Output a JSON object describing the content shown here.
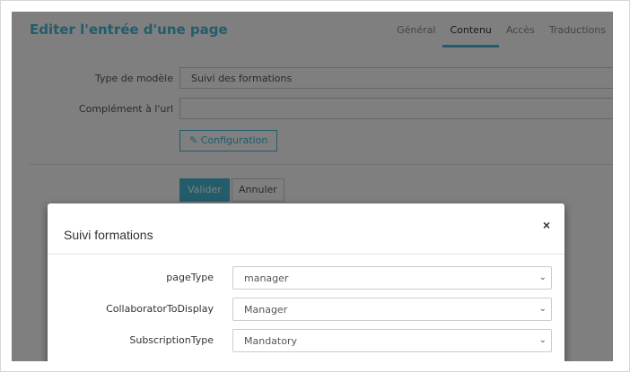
{
  "page": {
    "title": "Editer l'entrée d'une page",
    "tabs": [
      {
        "label": "Général",
        "active": false
      },
      {
        "label": "Contenu",
        "active": true
      },
      {
        "label": "Accès",
        "active": false
      },
      {
        "label": "Traductions",
        "active": false
      }
    ]
  },
  "form": {
    "template_type_label": "Type de modèle",
    "template_type_value": "Suivi des formations",
    "url_suffix_label": "Complément à l'url",
    "url_suffix_value": "",
    "config_button": "Configuration",
    "validate_button": "Valider",
    "cancel_button": "Annuler"
  },
  "modal": {
    "title": "Suivi formations",
    "close_label": "×",
    "fields": [
      {
        "label": "pageType",
        "value": "manager"
      },
      {
        "label": "CollaboratorToDisplay",
        "value": "Manager"
      },
      {
        "label": "SubscriptionType",
        "value": "Mandatory"
      }
    ]
  },
  "colors": {
    "accent": "#46b8d6",
    "overlay": "rgba(0,0,0,0.5)"
  },
  "icons": {
    "config": "pencil-icon",
    "dropdown": "chevron-down-icon",
    "close": "close-icon"
  }
}
